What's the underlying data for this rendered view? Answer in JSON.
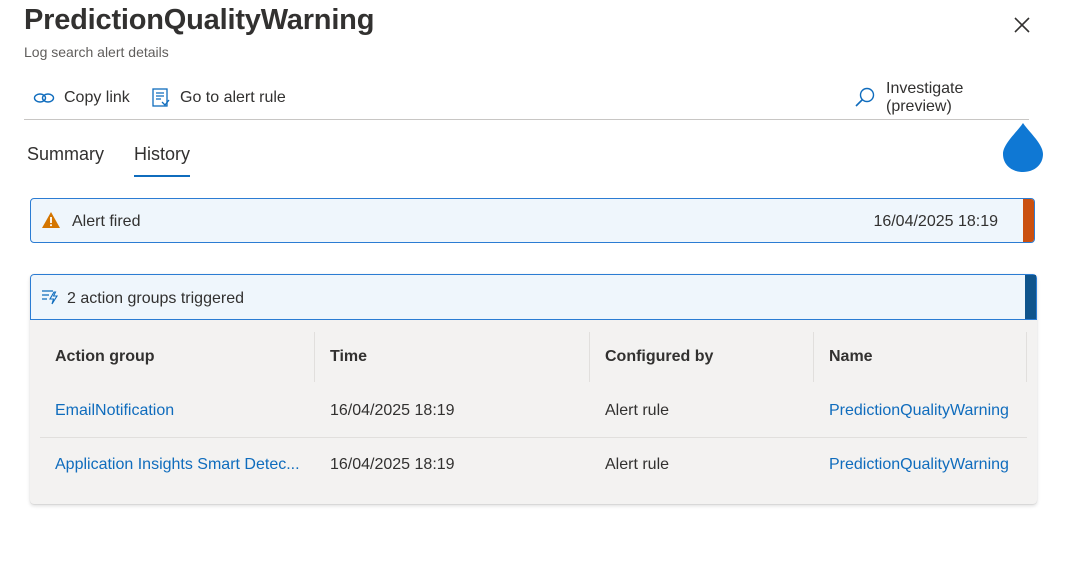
{
  "header": {
    "title": "PredictionQualityWarning",
    "subtitle": "Log search alert details"
  },
  "toolbar": {
    "copy_link": "Copy link",
    "go_to_alert_rule": "Go to alert rule",
    "investigate": "Investigate (preview)"
  },
  "tabs": [
    {
      "label": "Summary",
      "active": false
    },
    {
      "label": "History",
      "active": true
    }
  ],
  "alert_fired": {
    "label": "Alert fired",
    "time": "16/04/2025 18:19",
    "accent_color": "#ca5010"
  },
  "action_groups": {
    "label": "2 action groups triggered",
    "accent_color": "#0f548c",
    "columns": [
      "Action group",
      "Time",
      "Configured by",
      "Name"
    ],
    "rows": [
      {
        "action_group": "EmailNotification",
        "time": "16/04/2025 18:19",
        "configured_by": "Alert rule",
        "name": "PredictionQualityWarning"
      },
      {
        "action_group": "Application Insights Smart Detec...",
        "time": "16/04/2025 18:19",
        "configured_by": "Alert rule",
        "name": "PredictionQualityWarning"
      }
    ]
  },
  "colors": {
    "accent_blue": "#0f6cbd",
    "panel_bg": "#eff6fc",
    "card_bg": "#f3f2f1"
  },
  "icons": {
    "close": "close-icon",
    "copy_link": "link-icon",
    "go_to_rule": "rule-document-icon",
    "investigate": "search-icon",
    "warning": "warning-triangle-icon",
    "action_groups": "action-group-icon",
    "badge": "drop-badge-icon"
  }
}
